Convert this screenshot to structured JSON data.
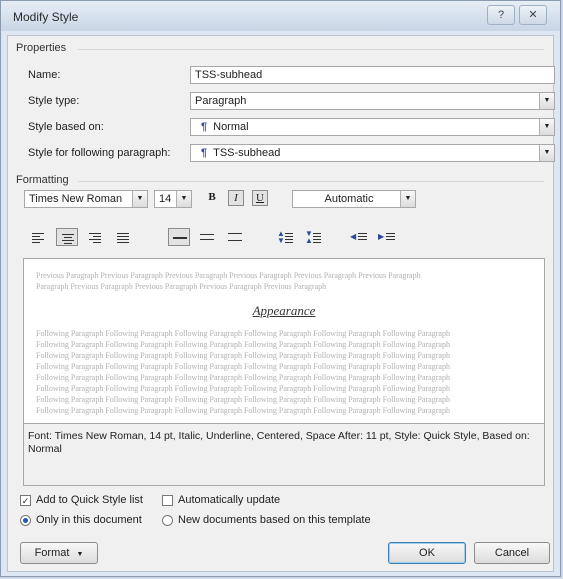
{
  "window": {
    "title": "Modify Style",
    "help_glyph": "?",
    "close_glyph": "✕"
  },
  "properties": {
    "group_label": "Properties",
    "name_label": "Name:",
    "name_value": "TSS-subhead",
    "style_type_label": "Style type:",
    "style_type_value": "Paragraph",
    "style_based_on_label": "Style based on:",
    "style_based_on_value": "Normal",
    "following_label": "Style for following paragraph:",
    "following_value": "TSS-subhead"
  },
  "formatting": {
    "group_label": "Formatting",
    "font_value": "Times New Roman",
    "size_value": "14",
    "bold_glyph": "B",
    "italic_glyph": "I",
    "underline_glyph": "U",
    "color_value": "Automatic"
  },
  "preview": {
    "previous_lines": [
      "Previous Paragraph Previous Paragraph Previous Paragraph Previous Paragraph Previous Paragraph Previous Paragraph",
      "Paragraph Previous Paragraph Previous Paragraph Previous Paragraph Previous Paragraph"
    ],
    "sample_text": "Appearance",
    "following_lines": [
      "Following Paragraph Following Paragraph Following Paragraph Following Paragraph Following Paragraph Following Paragraph",
      "Following Paragraph Following Paragraph Following Paragraph Following Paragraph Following Paragraph Following Paragraph",
      "Following Paragraph Following Paragraph Following Paragraph Following Paragraph Following Paragraph Following Paragraph",
      "Following Paragraph Following Paragraph Following Paragraph Following Paragraph Following Paragraph Following Paragraph",
      "Following Paragraph Following Paragraph Following Paragraph Following Paragraph Following Paragraph Following Paragraph",
      "Following Paragraph Following Paragraph Following Paragraph Following Paragraph Following Paragraph Following Paragraph",
      "Following Paragraph Following Paragraph Following Paragraph Following Paragraph Following Paragraph Following Paragraph",
      "Following Paragraph Following Paragraph Following Paragraph Following Paragraph Following Paragraph Following Paragraph"
    ]
  },
  "description": "Font: Times New Roman, 14 pt, Italic, Underline, Centered, Space After: 11 pt, Style: Quick Style, Based on: Normal",
  "options": {
    "add_quick_style": "Add to Quick Style list",
    "add_quick_style_checked": true,
    "auto_update": "Automatically update",
    "auto_update_checked": false,
    "only_this_doc": "Only in this document",
    "new_docs": "New documents based on this template"
  },
  "buttons": {
    "format": "Format",
    "format_arrow": "▼",
    "ok": "OK",
    "cancel": "Cancel"
  },
  "colors": {
    "accent": "#2a55b8",
    "pilcrow": "#3b4fa3"
  }
}
